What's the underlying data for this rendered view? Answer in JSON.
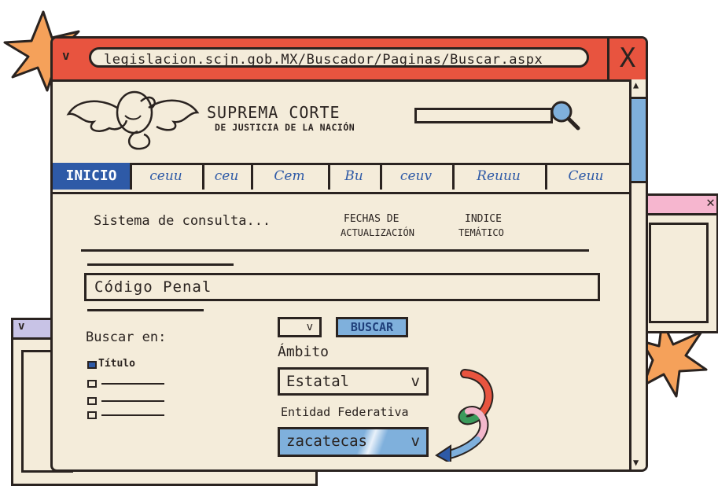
{
  "browser": {
    "url": "legislacion.scjn.gob.MX/Buscador/Paginas/Buscar.aspx",
    "close_glyph": "X",
    "menu_glyph": "v"
  },
  "header": {
    "title_line1": "SUPREMA CORTE",
    "title_line2": "DE JUSTICIA DE LA NACIÓN"
  },
  "nav": {
    "items": [
      "INICIO",
      "ceuu",
      "ceu",
      "Cem",
      "Bu",
      "ceuv",
      "Reuuu",
      "Ceuu"
    ]
  },
  "content": {
    "system_link": "Sistema de consulta...",
    "dates_line1": "FECHAS DE",
    "dates_line2": "ACTUALIZACIÓN",
    "index_line1": "INDICE",
    "index_line2": "TEMÁTICO",
    "search_value": "Código Penal",
    "buscar_label": "BUSCAR",
    "small_select_value": "",
    "search_in_label": "Buscar en:",
    "title_option": "Título",
    "ambito_label": "Ámbito",
    "ambito_value": "Estatal",
    "entidad_label": "Entidad Federativa",
    "entidad_value": "zacatecas",
    "dropdown_glyph": "v"
  },
  "colors": {
    "titlebar": "#e8543f",
    "page": "#f4ecda",
    "accent_blue": "#7fb0dc",
    "link_blue": "#2e5aa7",
    "burst": "#f5a15a"
  }
}
